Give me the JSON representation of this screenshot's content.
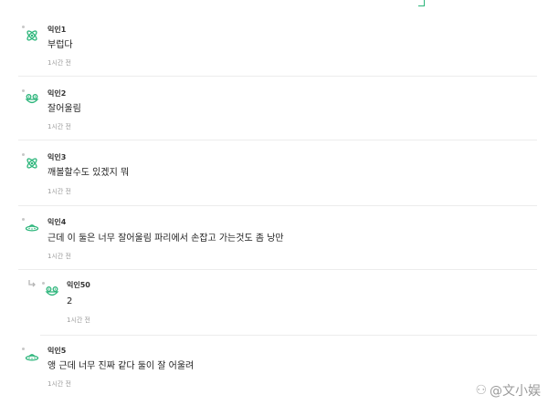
{
  "comments": [
    {
      "author": "익인1",
      "body": "부럽다",
      "time": "1시간 전",
      "avatar": "atom-icon"
    },
    {
      "author": "익인2",
      "body": "잘어울림",
      "time": "1시간 전",
      "avatar": "frog-icon"
    },
    {
      "author": "익인3",
      "body": "깨볼할수도 있겠지 뭐",
      "time": "1시간 전",
      "avatar": "atom-icon"
    },
    {
      "author": "익인4",
      "body": "근데 이 둘은 너무 잘어울림 파리에서 손잡고 가는것도 좀 낭만",
      "time": "1시간 전",
      "avatar": "ufo-icon"
    },
    {
      "author": "익인50",
      "body": "2",
      "time": "1시간 전",
      "avatar": "frog-icon",
      "reply": true
    },
    {
      "author": "익인5",
      "body": "앵 근데 너무 진짜 같다 둘이 잘 어울려",
      "time": "1시간 전",
      "avatar": "ufo-icon"
    }
  ],
  "watermark": {
    "glyph": "⚇",
    "text": "@文小娱"
  },
  "colors": {
    "accent": "#2bb57a",
    "time": "#9a9a9a",
    "divider": "#ececec"
  }
}
